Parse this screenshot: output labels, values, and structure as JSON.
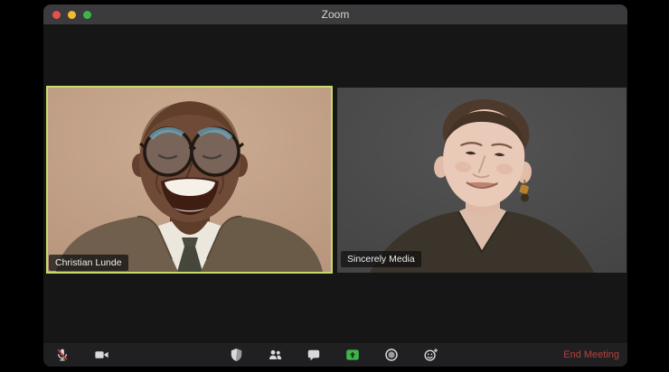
{
  "window": {
    "title": "Zoom",
    "traffic_lights": [
      "close",
      "minimize",
      "zoom-fullscreen"
    ]
  },
  "participants": [
    {
      "name": "Christian Lunde",
      "active_speaker": true
    },
    {
      "name": "Sincerely Media",
      "active_speaker": false
    }
  ],
  "toolbar": {
    "items": [
      {
        "id": "mute",
        "icon": "microphone-muted-icon",
        "state": "muted"
      },
      {
        "id": "video",
        "icon": "video-camera-icon"
      },
      {
        "id": "security",
        "icon": "shield-icon"
      },
      {
        "id": "participants",
        "icon": "participants-icon"
      },
      {
        "id": "chat",
        "icon": "chat-bubble-icon"
      },
      {
        "id": "share-screen",
        "icon": "share-screen-icon"
      },
      {
        "id": "record",
        "icon": "record-icon"
      },
      {
        "id": "reactions",
        "icon": "reactions-smiley-icon"
      }
    ],
    "end_meeting_label": "End Meeting"
  },
  "colors": {
    "active_speaker_border": "#ccd96b",
    "share_screen_green": "#3eb549",
    "end_meeting_red": "#b5433e",
    "titlebar_bg": "#3b3b3d",
    "toolbar_bg": "#202023",
    "window_bg": "#161616",
    "traffic_red": "#e5504b",
    "traffic_yellow": "#f0bc2e",
    "traffic_green": "#3db54a"
  }
}
